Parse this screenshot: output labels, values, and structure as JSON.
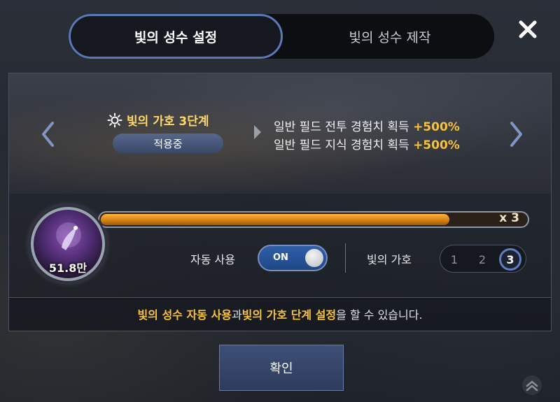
{
  "tabs": [
    {
      "label": "빛의 성수 설정",
      "active": true
    },
    {
      "label": "빛의 성수 제작",
      "active": false
    }
  ],
  "info": {
    "stage_title": "빛의 가호 3단계",
    "status": "적용중",
    "bonuses": [
      {
        "text": "일반 필드 전투 경험치 획득 ",
        "value": "+500%"
      },
      {
        "text": "일반 필드 지식 경험치 획득 ",
        "value": "+500%"
      }
    ]
  },
  "holy_water": {
    "amount": "51.8만",
    "multiplier": "x 3",
    "fill_fraction": 0.82
  },
  "controls": {
    "auto_use_label": "자동 사용",
    "toggle_text": "ON",
    "blessing_label": "빛의 가호",
    "levels": [
      "1",
      "2",
      "3"
    ],
    "selected_level": "3"
  },
  "hint": {
    "part1": "빛의 성수 자동 사용",
    "part2": "과 ",
    "part3": "빛의 가호 단계 설정",
    "part4": "을 할 수 있습니다."
  },
  "confirm_label": "확인",
  "colors": {
    "accent_gold": "#f7c23c",
    "accent_blue": "#5b79b7"
  },
  "icons": {
    "close": "close-icon",
    "stage": "sun-emblem-icon",
    "left": "chevron-left-icon",
    "right": "chevron-right-icon"
  }
}
